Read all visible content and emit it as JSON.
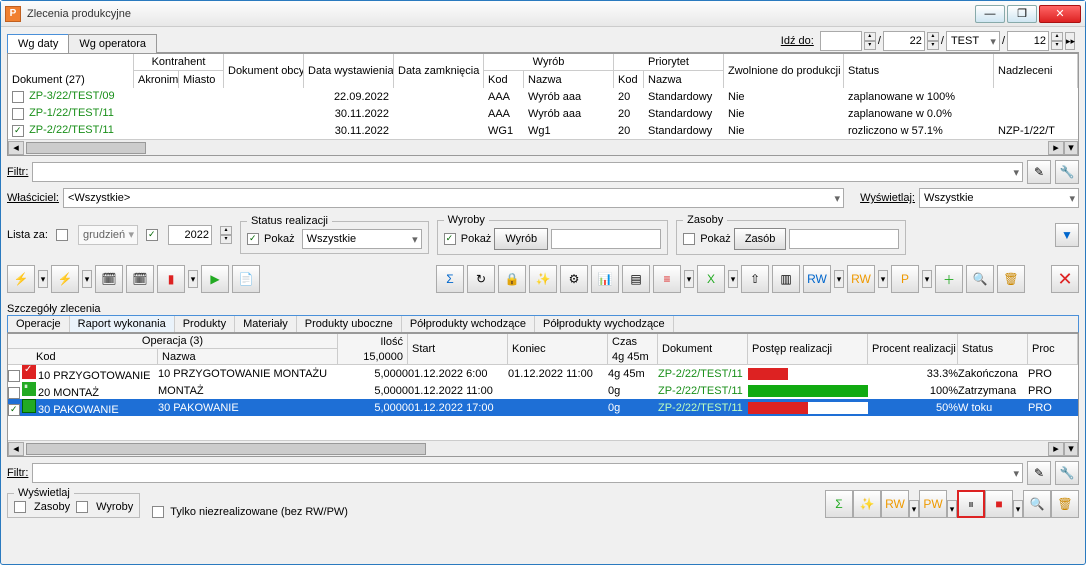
{
  "window": {
    "title": "Zlecenia produkcyjne",
    "icon_letter": "P"
  },
  "goto": {
    "label": "Idź do:",
    "field1": "",
    "field2": "22",
    "field3": "TEST",
    "field4": "12"
  },
  "tabs_top": [
    {
      "label": "Wg daty",
      "active": true
    },
    {
      "label": "Wg operatora",
      "active": false
    }
  ],
  "grid": {
    "doc_header": "Dokument (27)",
    "headers": {
      "kontrahent": "Kontrahent",
      "akronim": "Akronim",
      "miasto": "Miasto",
      "dok_obcy": "Dokument obcy",
      "data_wyst": "Data wystawienia",
      "data_zamk": "Data zamknięcia",
      "wyrob": "Wyrób",
      "kod": "Kod",
      "nazwa": "Nazwa",
      "priorytet": "Priorytet",
      "zwolnione": "Zwolnione do produkcji",
      "status": "Status",
      "nadzlec": "Nadzleceni"
    },
    "rows": [
      {
        "checked": false,
        "doc": "ZP-3/22/TEST/09",
        "data_wyst": "22.09.2022",
        "kod": "AAA",
        "nazwa": "Wyrób aaa",
        "pkod": "20",
        "pnazwa": "Standardowy",
        "zw": "Nie",
        "status": "zaplanowane w 100%",
        "nad": ""
      },
      {
        "checked": false,
        "doc": "ZP-1/22/TEST/11",
        "data_wyst": "30.11.2022",
        "kod": "AAA",
        "nazwa": "Wyrób aaa",
        "pkod": "20",
        "pnazwa": "Standardowy",
        "zw": "Nie",
        "status": "zaplanowane w 0.0%",
        "nad": ""
      },
      {
        "checked": true,
        "doc": "ZP-2/22/TEST/11",
        "data_wyst": "30.11.2022",
        "kod": "WG1",
        "nazwa": "Wg1",
        "pkod": "20",
        "pnazwa": "Standardowy",
        "zw": "Nie",
        "status": "rozliczono w 57.1%",
        "nad": "NZP-1/22/T"
      }
    ]
  },
  "filter": {
    "filtr_label": "Filtr:",
    "wlasciciel_label": "Właściciel:",
    "wlasciciel_value": "<Wszystkie>",
    "wyswietlaj_label": "Wyświetlaj:",
    "wyswietlaj_value": "Wszystkie"
  },
  "filters2": {
    "lista_za": "Lista za:",
    "month": "grudzień",
    "year": "2022",
    "status_realizacji": "Status realizacji",
    "pokaz": "Pokaż",
    "wszystkie": "Wszystkie",
    "wyroby": "Wyroby",
    "wyrob_btn": "Wyrób",
    "zasoby": "Zasoby",
    "zasob_btn": "Zasób"
  },
  "details": {
    "title": "Szczegóły zlecenia",
    "tabs": [
      {
        "label": "Operacje",
        "active": false
      },
      {
        "label": "Raport wykonania",
        "active": true
      },
      {
        "label": "Produkty",
        "active": false
      },
      {
        "label": "Materiały",
        "active": false
      },
      {
        "label": "Produkty uboczne",
        "active": false
      },
      {
        "label": "Półprodukty wchodzące",
        "active": false
      },
      {
        "label": "Półprodukty wychodzące",
        "active": false
      }
    ],
    "op_head": {
      "operacja": "Operacja (3)",
      "kod": "Kod",
      "nazwa": "Nazwa",
      "ilosc": "Ilość",
      "ilosc_sum": "15,0000",
      "start": "Start",
      "koniec": "Koniec",
      "czas": "Czas",
      "czas_sum": "4g 45m",
      "dokument": "Dokument",
      "postep": "Postęp realizacji",
      "procent": "Procent realizacji",
      "status": "Status",
      "proc_col": "Proc"
    },
    "ops": [
      {
        "icon": "done",
        "kod": "10 PRZYGOTOWANIE",
        "nazwa": "10 PRZYGOTOWANIE MONTAŻU",
        "ilosc": "5,0000",
        "start": "01.12.2022 6:00",
        "koniec": "01.12.2022 11:00",
        "czas": "4g 45m",
        "dok": "ZP-2/22/TEST/11",
        "bar_color": "#d22",
        "bar_pct": 33,
        "procent": "33.3%",
        "status": "Zakończona",
        "proc": "PRO"
      },
      {
        "icon": "paused",
        "kod": "20 MONTAŻ",
        "nazwa": "MONTAŻ",
        "ilosc": "5,0000",
        "start": "01.12.2022 11:00",
        "koniec": "",
        "czas": "0g",
        "dok": "ZP-2/22/TEST/11",
        "bar_color": "#1a1",
        "bar_pct": 100,
        "procent": "100%",
        "status": "Zatrzymana",
        "proc": "PRO"
      },
      {
        "icon": "run",
        "kod": "30 PAKOWANIE",
        "nazwa": "30 PAKOWANIE",
        "ilosc": "5,0000",
        "start": "01.12.2022 17:00",
        "koniec": "",
        "czas": "0g",
        "dok": "ZP-2/22/TEST/11",
        "bar_color": "#d22",
        "bar_pct": 50,
        "procent": "50%",
        "status": "W toku",
        "proc": "PRO",
        "selected": true
      }
    ]
  },
  "bottom": {
    "filtr": "Filtr:",
    "wyswietlaj": "Wyświetlaj",
    "zasoby": "Zasoby",
    "wyroby": "Wyroby",
    "tylko": "Tylko niezrealizowane (bez RW/PW)"
  }
}
